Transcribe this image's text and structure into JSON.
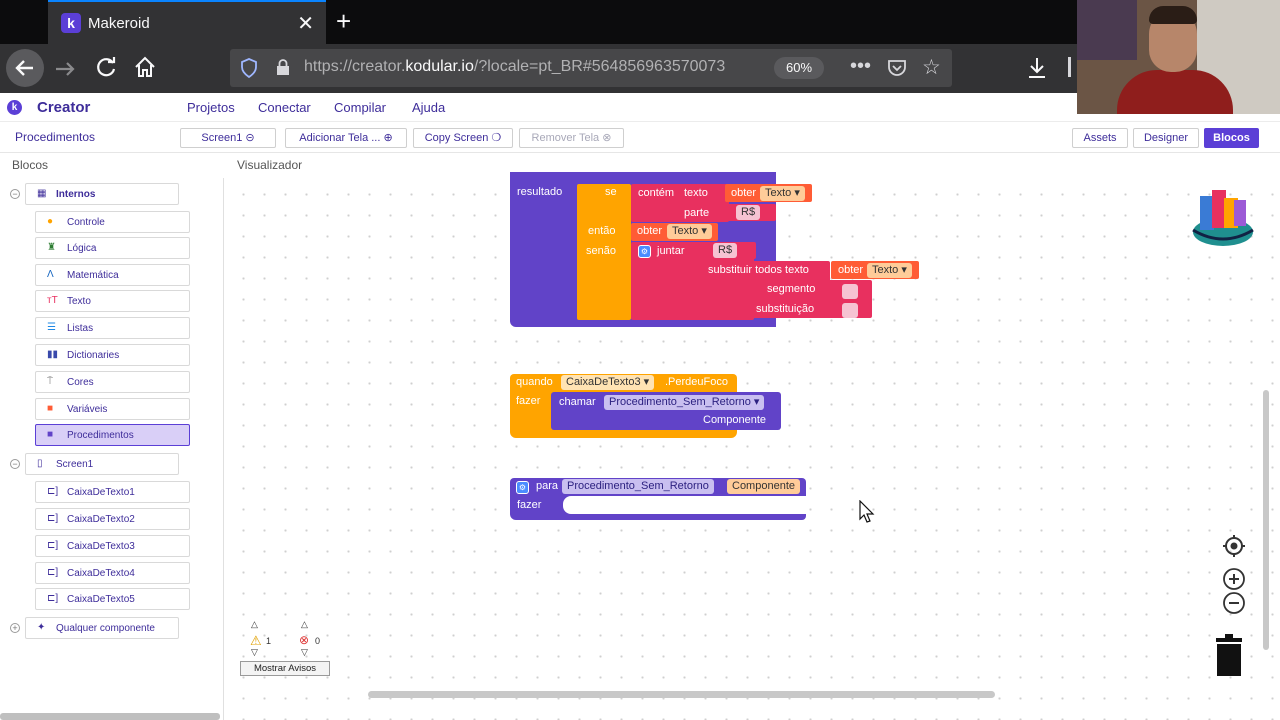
{
  "browser": {
    "tab_title": "Makeroid",
    "tab_close": "✕",
    "new_tab": "+",
    "url_prefix": "https://creator.",
    "url_domain": "kodular.io",
    "url_rest": "/?locale=pt_BR#564856963570073",
    "zoom": "60%"
  },
  "app": {
    "brand": "Creator",
    "menu": [
      "Projetos",
      "Conectar",
      "Compilar",
      "Ajuda"
    ]
  },
  "toolbar": {
    "crumb": "Procedimentos",
    "screen_select": "Screen1",
    "add_screen": "Adicionar Tela ...",
    "copy_screen": "Copy Screen",
    "remove_screen": "Remover Tela",
    "assets": "Assets",
    "designer": "Designer",
    "blocks": "Blocos"
  },
  "panels": {
    "left_title": "Blocos",
    "right_title": "Visualizador"
  },
  "tree": {
    "internos": "Internos",
    "builtins": [
      "Controle",
      "Lógica",
      "Matemática",
      "Texto",
      "Listas",
      "Dictionaries",
      "Cores",
      "Variáveis",
      "Procedimentos"
    ],
    "screen": "Screen1",
    "components": [
      "CaixaDeTexto1",
      "CaixaDeTexto2",
      "CaixaDeTexto3",
      "CaixaDeTexto4",
      "CaixaDeTexto5"
    ],
    "any": "Qualquer componente"
  },
  "blocks": {
    "b1": {
      "resultado": "resultado",
      "se": "se",
      "contem": "contém",
      "texto": "texto",
      "obter": "obter",
      "var_texto": "Texto",
      "parte": "parte",
      "rs": "R$",
      "entao": "então",
      "senao": "senão",
      "juntar": "juntar",
      "substituir": "substituir todos texto",
      "segmento": "segmento",
      "substituicao": "substituição"
    },
    "b2": {
      "quando": "quando",
      "comp": "CaixaDeTexto3",
      "event": ".PerdeuFoco",
      "fazer": "fazer",
      "chamar": "chamar",
      "proc": "Procedimento_Sem_Retorno",
      "arg": "Componente"
    },
    "b3": {
      "para": "para",
      "proc": "Procedimento_Sem_Retorno",
      "param": "Componente",
      "fazer": "fazer"
    }
  },
  "warnings": {
    "warn_count": "1",
    "error_count": "0",
    "show": "Mostrar Avisos"
  },
  "colors": {
    "procedure": "#6143c8",
    "control": "#ffa400",
    "text": "#e8305f",
    "variable": "#ff5c35",
    "accent": "#5b3fd6"
  }
}
